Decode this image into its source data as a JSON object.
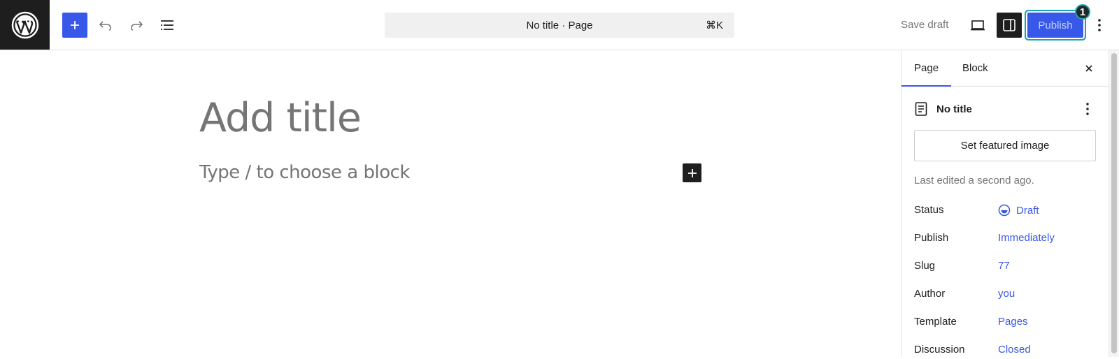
{
  "toolbar": {
    "logo_icon": "wordpress-logo",
    "inserter_icon": "plus-icon",
    "undo_icon": "undo-icon",
    "redo_icon": "redo-icon",
    "list_view_icon": "list-view-icon",
    "command_title": "No title · Page",
    "command_shortcut": "⌘K",
    "save_draft_label": "Save draft",
    "preview_icon": "desktop-preview-icon",
    "settings_icon": "sidebar-settings-icon",
    "publish_label": "Publish",
    "badge_count": "1",
    "more_icon": "vertical-ellipsis-icon"
  },
  "editor": {
    "title_placeholder": "Add title",
    "block_placeholder": "Type / to choose a block"
  },
  "sidebar": {
    "tabs": [
      {
        "label": "Page",
        "active": true
      },
      {
        "label": "Block",
        "active": false
      }
    ],
    "document_title": "No title",
    "featured_image_label": "Set featured image",
    "last_edited": "Last edited a second ago.",
    "meta": [
      {
        "label": "Status",
        "value": "Draft"
      },
      {
        "label": "Publish",
        "value": "Immediately"
      },
      {
        "label": "Slug",
        "value": "77"
      },
      {
        "label": "Author",
        "value": "you"
      },
      {
        "label": "Template",
        "value": "Pages"
      },
      {
        "label": "Discussion",
        "value": "Closed"
      }
    ]
  },
  "colors": {
    "accent": "#3858e9",
    "dark": "#1e1e1e",
    "muted": "#757575"
  }
}
